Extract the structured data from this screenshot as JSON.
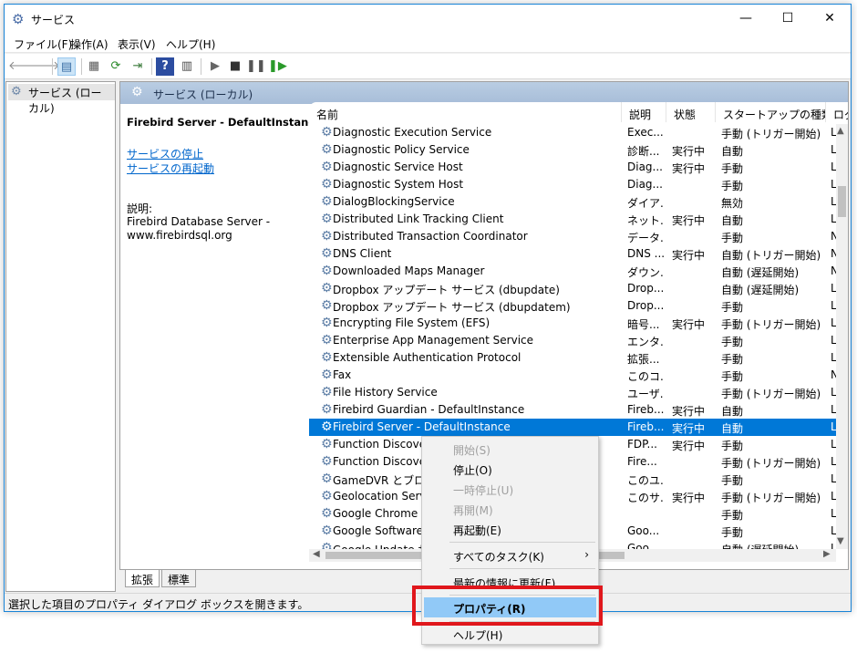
{
  "window": {
    "title": "サービス",
    "controls": {
      "minimize": "—",
      "maximize": "☐",
      "close": "✕"
    }
  },
  "menu": [
    "ファイル(F)",
    "操作(A)",
    "表示(V)",
    "ヘルプ(H)"
  ],
  "toolbar_icons": [
    "back-arrow-icon",
    "forward-arrow-icon",
    "console-tree-icon",
    "properties-icon",
    "refresh-icon",
    "export-list-icon",
    "help-icon",
    "view-icon",
    "start-icon",
    "stop-icon",
    "pause-icon",
    "restart-icon"
  ],
  "tree": {
    "item": "サービス (ローカル)"
  },
  "pane": {
    "header": "サービス (ローカル)",
    "selected_service": "Firebird Server - DefaultInstance",
    "links": {
      "stop": "サービスの停止",
      "restart": "サービスの再起動"
    },
    "description_label": "説明:",
    "description": "Firebird Database Server - www.firebirdsql.org"
  },
  "columns": [
    "名前",
    "説明",
    "状態",
    "スタートアップの種類",
    "ログ"
  ],
  "rows": [
    {
      "name": "Diagnostic Execution Service",
      "desc": "Exec...",
      "status": "",
      "startup": "手動 (トリガー開始)",
      "logon": "Lo"
    },
    {
      "name": "Diagnostic Policy Service",
      "desc": "診断...",
      "status": "実行中",
      "startup": "自動",
      "logon": "Lo"
    },
    {
      "name": "Diagnostic Service Host",
      "desc": "Diag...",
      "status": "実行中",
      "startup": "手動",
      "logon": "Lo"
    },
    {
      "name": "Diagnostic System Host",
      "desc": "Diag...",
      "status": "",
      "startup": "手動",
      "logon": "Lo"
    },
    {
      "name": "DialogBlockingService",
      "desc": "ダイア...",
      "status": "",
      "startup": "無効",
      "logon": "Lo"
    },
    {
      "name": "Distributed Link Tracking Client",
      "desc": "ネット...",
      "status": "実行中",
      "startup": "自動",
      "logon": "Lo"
    },
    {
      "name": "Distributed Transaction Coordinator",
      "desc": "データ...",
      "status": "",
      "startup": "手動",
      "logon": "N"
    },
    {
      "name": "DNS Client",
      "desc": "DNS ...",
      "status": "実行中",
      "startup": "自動 (トリガー開始)",
      "logon": "N"
    },
    {
      "name": "Downloaded Maps Manager",
      "desc": "ダウン...",
      "status": "",
      "startup": "自動 (遅延開始)",
      "logon": "N"
    },
    {
      "name": "Dropbox アップデート サービス (dbupdate)",
      "desc": "Drop...",
      "status": "",
      "startup": "自動 (遅延開始)",
      "logon": "Lo"
    },
    {
      "name": "Dropbox アップデート サービス (dbupdatem)",
      "desc": "Drop...",
      "status": "",
      "startup": "手動",
      "logon": "Lo"
    },
    {
      "name": "Encrypting File System (EFS)",
      "desc": "暗号...",
      "status": "実行中",
      "startup": "手動 (トリガー開始)",
      "logon": "Lo"
    },
    {
      "name": "Enterprise App Management Service",
      "desc": "エンタ...",
      "status": "",
      "startup": "手動",
      "logon": "Lo"
    },
    {
      "name": "Extensible Authentication Protocol",
      "desc": "拡張...",
      "status": "",
      "startup": "手動",
      "logon": "Lo"
    },
    {
      "name": "Fax",
      "desc": "このコ...",
      "status": "",
      "startup": "手動",
      "logon": "N"
    },
    {
      "name": "File History Service",
      "desc": "ユーザ...",
      "status": "",
      "startup": "手動 (トリガー開始)",
      "logon": "Lo"
    },
    {
      "name": "Firebird Guardian - DefaultInstance",
      "desc": "Fireb...",
      "status": "実行中",
      "startup": "自動",
      "logon": "Lo"
    },
    {
      "name": "Firebird Server - DefaultInstance",
      "desc": "Fireb...",
      "status": "実行中",
      "startup": "自動",
      "logon": "Lo",
      "selected": true
    },
    {
      "name": "Function Discover",
      "desc": "FDP...",
      "status": "実行中",
      "startup": "手動",
      "logon": "Lo"
    },
    {
      "name": "Function Discover",
      "desc": "Fire...",
      "status": "",
      "startup": "手動 (トリガー開始)",
      "logon": "Lo"
    },
    {
      "name": "GameDVR とブロード",
      "desc": "このユ...",
      "status": "",
      "startup": "手動",
      "logon": "Lo"
    },
    {
      "name": "Geolocation Servic",
      "desc": "このサ...",
      "status": "実行中",
      "startup": "手動 (トリガー開始)",
      "logon": "Lo"
    },
    {
      "name": "Google Chrome El",
      "desc": "",
      "status": "",
      "startup": "手動",
      "logon": "Lo"
    },
    {
      "name": "Google Software U",
      "desc": "Goo...",
      "status": "",
      "startup": "手動",
      "logon": "Lo"
    },
    {
      "name": "Google Update サ",
      "desc": "Goo...",
      "status": "",
      "startup": "自動 (遅延開始)",
      "logon": "Lo"
    }
  ],
  "tabs": [
    "拡張",
    "標準"
  ],
  "status_bar": "選択した項目のプロパティ ダイアログ ボックスを開きます。",
  "context_menu": [
    {
      "label": "開始(S)",
      "disabled": true
    },
    {
      "label": "停止(O)",
      "disabled": false
    },
    {
      "label": "一時停止(U)",
      "disabled": true
    },
    {
      "label": "再開(M)",
      "disabled": true
    },
    {
      "label": "再起動(E)",
      "disabled": false
    },
    {
      "label": "すべてのタスク(K)",
      "disabled": false,
      "submenu": true
    },
    {
      "label": "最新の情報に更新(F)",
      "disabled": false
    },
    {
      "label": "プロパティ(R)",
      "disabled": false,
      "hover": true,
      "bold": true
    },
    {
      "label": "ヘルプ(H)",
      "disabled": false
    }
  ],
  "colors": {
    "selection": "#0078d7",
    "menu_hover": "#91c9f7",
    "highlight_box": "#e0171c",
    "link": "#0066cc"
  }
}
